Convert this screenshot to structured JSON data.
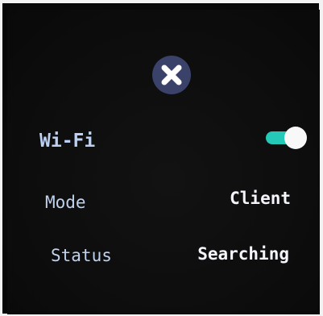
{
  "header": {
    "close_icon": "close-icon"
  },
  "wifi": {
    "label": "Wi-Fi",
    "enabled": true,
    "toggle_color": "#25c9b8"
  },
  "mode": {
    "label": "Mode",
    "value": "Client"
  },
  "status": {
    "label": "Status",
    "value": "Searching"
  },
  "colors": {
    "close_button_bg": "#3b4269",
    "label_text": "#bfd2ee",
    "value_text": "#f4f6fb"
  }
}
